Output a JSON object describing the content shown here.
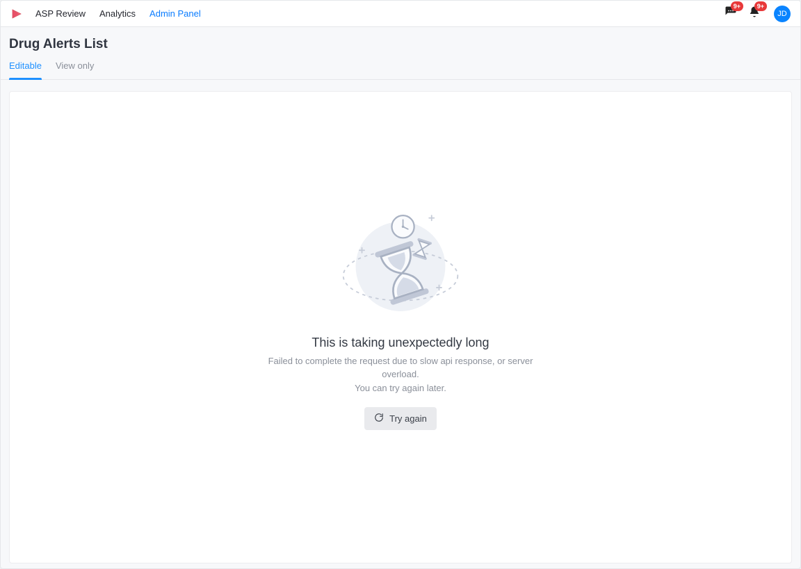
{
  "nav": {
    "items": [
      {
        "label": "ASP Review",
        "active": false
      },
      {
        "label": "Analytics",
        "active": false
      },
      {
        "label": "Admin Panel",
        "active": true
      }
    ],
    "messages_badge": "9+",
    "notifications_badge": "9+",
    "avatar_initials": "JD"
  },
  "page": {
    "title": "Drug Alerts List",
    "tabs": [
      {
        "label": "Editable",
        "active": true
      },
      {
        "label": "View only",
        "active": false
      }
    ]
  },
  "error": {
    "title": "This is taking unexpectedly long",
    "subtitle_line1": "Failed to complete the request due to slow api response, or server overload.",
    "subtitle_line2": "You can try again later.",
    "retry_label": "Try again"
  },
  "icons": {
    "messages": "chat-icon",
    "notifications": "bell-icon",
    "retry": "refresh-icon",
    "logo": "app-logo-icon"
  }
}
